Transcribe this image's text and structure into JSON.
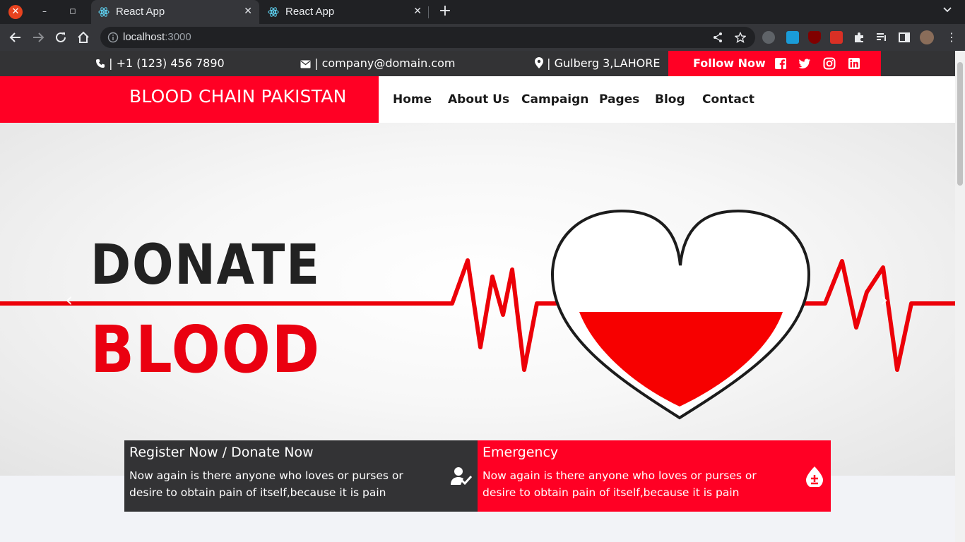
{
  "browser": {
    "tabs": [
      {
        "title": "React App",
        "active": true
      },
      {
        "title": "React App",
        "active": false
      }
    ],
    "url_host": "localhost",
    "url_port": ":3000"
  },
  "topbar": {
    "phone": "| +1 (123) 456 7890",
    "email": "| company@domain.com",
    "address": "Gulberg 3,LAHORE",
    "follow_label": "Follow Now",
    "socials": [
      "facebook-icon",
      "twitter-icon",
      "instagram-icon",
      "linkedin-icon"
    ]
  },
  "nav": {
    "brand": "BLOOD CHAIN PAKISTAN",
    "items": [
      "Home",
      "About Us",
      "Campaign",
      "Pages",
      "Blog",
      "Contact"
    ]
  },
  "hero": {
    "line1": "DONATE",
    "line2": "BLOOD"
  },
  "cards": {
    "register": {
      "title": "Register Now / Donate Now",
      "text": "Now again is there anyone who loves or purses or desire to obtain pain of itself,because it is pain"
    },
    "emergency": {
      "title": "Emergency",
      "text": "Now again is there anyone who loves or purses or desire to obtain pain of itself,because it is pain"
    }
  },
  "colors": {
    "brand_red": "#ff0024",
    "dark": "#333335"
  }
}
